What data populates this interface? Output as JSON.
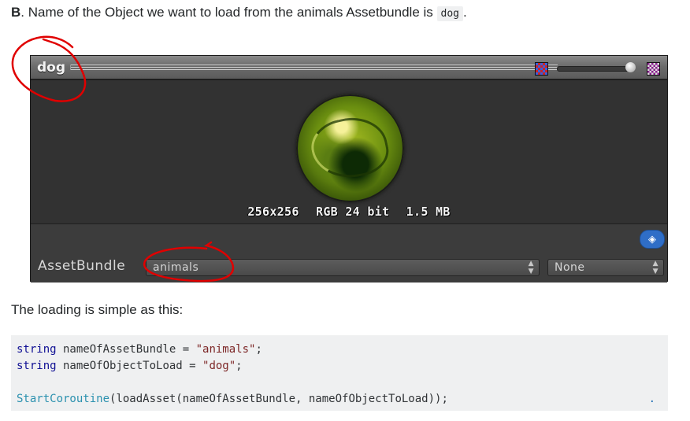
{
  "intro": {
    "label": "B",
    "text": ". Name of the Object we want to load from the animals Assetbundle is ",
    "code": "dog",
    "end": "."
  },
  "inspector": {
    "asset_name": "dog",
    "icons": [
      "rgb-channel-icon",
      "mip-level-slider",
      "alpha-channel-icon"
    ],
    "mip_level": 0.9,
    "preview_info": {
      "size": "256x256",
      "format": "RGB 24 bit",
      "filesize": "1.5 MB"
    },
    "assetbundle_label": "AssetBundle",
    "assetbundle_value": "animals",
    "variant_value": "None",
    "tag_icon": "tag-icon"
  },
  "loading_text": "The loading is simple as this:",
  "code": {
    "line1": {
      "type": "string",
      "name": " nameOfAssetBundle = ",
      "value": "\"animals\"",
      "end": ";"
    },
    "line2": {
      "type": "string",
      "name": " nameOfObjectToLoad = ",
      "value": "\"dog\"",
      "end": ";"
    },
    "line4": {
      "fn": "StartCoroutine",
      "rest": "(loadAsset(nameOfAssetBundle, nameOfObjectToLoad));"
    },
    "trail": "."
  },
  "colors": {
    "annotation": "#e00000",
    "code_bg": "#eff0f1",
    "tag_badge": "#2f6ec7"
  }
}
